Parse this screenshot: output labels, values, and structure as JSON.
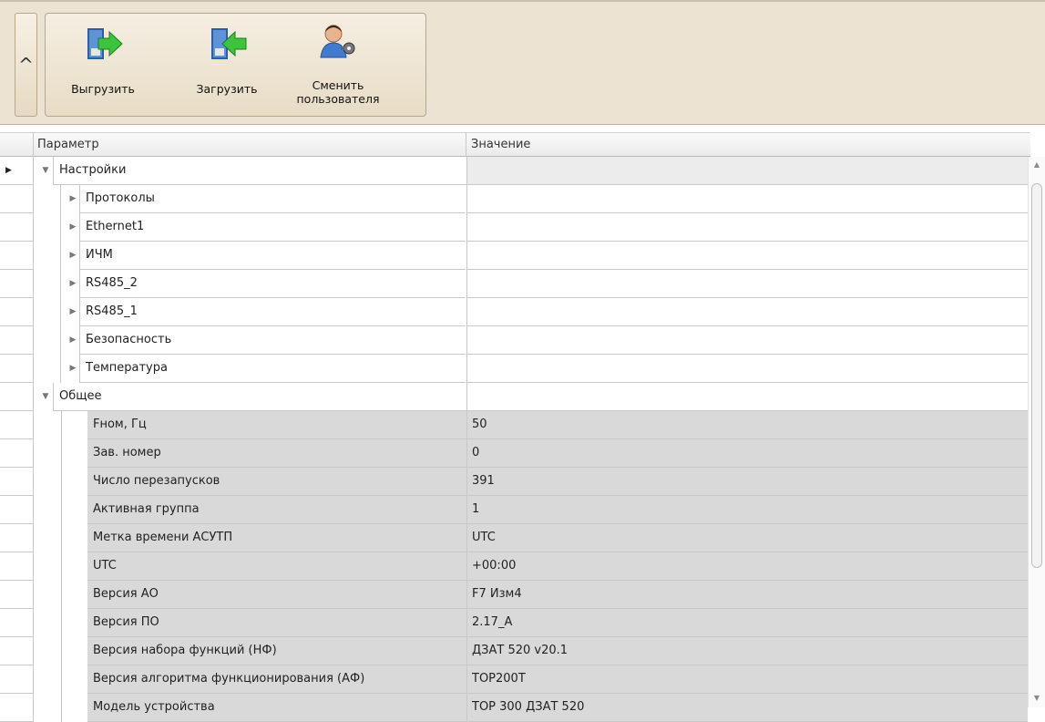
{
  "ribbon": {
    "collapse_glyph": "^",
    "buttons": [
      {
        "label": "Выгрузить",
        "icon": "upload-arrow-icon"
      },
      {
        "label": "Загрузить",
        "icon": "download-arrow-icon"
      },
      {
        "label_line1": "Сменить",
        "label_line2": "пользователя",
        "icon": "change-user-key-icon"
      }
    ]
  },
  "grid": {
    "columns": {
      "parameter": "Параметр",
      "value": "Значение"
    },
    "rows": [
      {
        "level": 0,
        "name": "Настройки",
        "value": "",
        "expanded": true,
        "current": true
      },
      {
        "level": 1,
        "name": "Протоколы",
        "value": "",
        "expanded": false
      },
      {
        "level": 1,
        "name": "Ethernet1",
        "value": "",
        "expanded": false
      },
      {
        "level": 1,
        "name": "ИЧМ",
        "value": "",
        "expanded": false
      },
      {
        "level": 1,
        "name": "RS485_2",
        "value": "",
        "expanded": false
      },
      {
        "level": 1,
        "name": "RS485_1",
        "value": "",
        "expanded": false
      },
      {
        "level": 1,
        "name": "Безопасность",
        "value": "",
        "expanded": false
      },
      {
        "level": 1,
        "name": "Температура",
        "value": "",
        "expanded": false
      },
      {
        "level": 0,
        "name": "Общее",
        "value": "",
        "expanded": true
      },
      {
        "level": 2,
        "name": "Fном, Гц",
        "value": "50"
      },
      {
        "level": 2,
        "name": "Зав. номер",
        "value": "0"
      },
      {
        "level": 2,
        "name": "Число перезапусков",
        "value": "391"
      },
      {
        "level": 2,
        "name": "Активная группа",
        "value": "1"
      },
      {
        "level": 2,
        "name": "Метка времени АСУТП",
        "value": "UTC"
      },
      {
        "level": 2,
        "name": "UTC",
        "value": "+00:00"
      },
      {
        "level": 2,
        "name": "Версия АО",
        "value": "F7 Изм4"
      },
      {
        "level": 2,
        "name": "Версия ПО",
        "value": "2.17_A"
      },
      {
        "level": 2,
        "name": "Версия набора функций (НФ)",
        "value": "ДЗАТ 520 v20.1"
      },
      {
        "level": 2,
        "name": "Версия алгоритма функционирования (АФ)",
        "value": "TOP200T"
      },
      {
        "level": 2,
        "name": "Модель устройства",
        "value": "TOP 300 ДЗАТ 520"
      }
    ]
  },
  "glyphs": {
    "current_row": "▶",
    "expanded": "▼",
    "collapsed": "▶",
    "scroll_up": "▲",
    "scroll_down": "▼"
  },
  "colors": {
    "ribbon_bg": "#ece3d2",
    "leaf_row_bg": "#d9d9d9",
    "arrow_green": "#3cc43c"
  }
}
